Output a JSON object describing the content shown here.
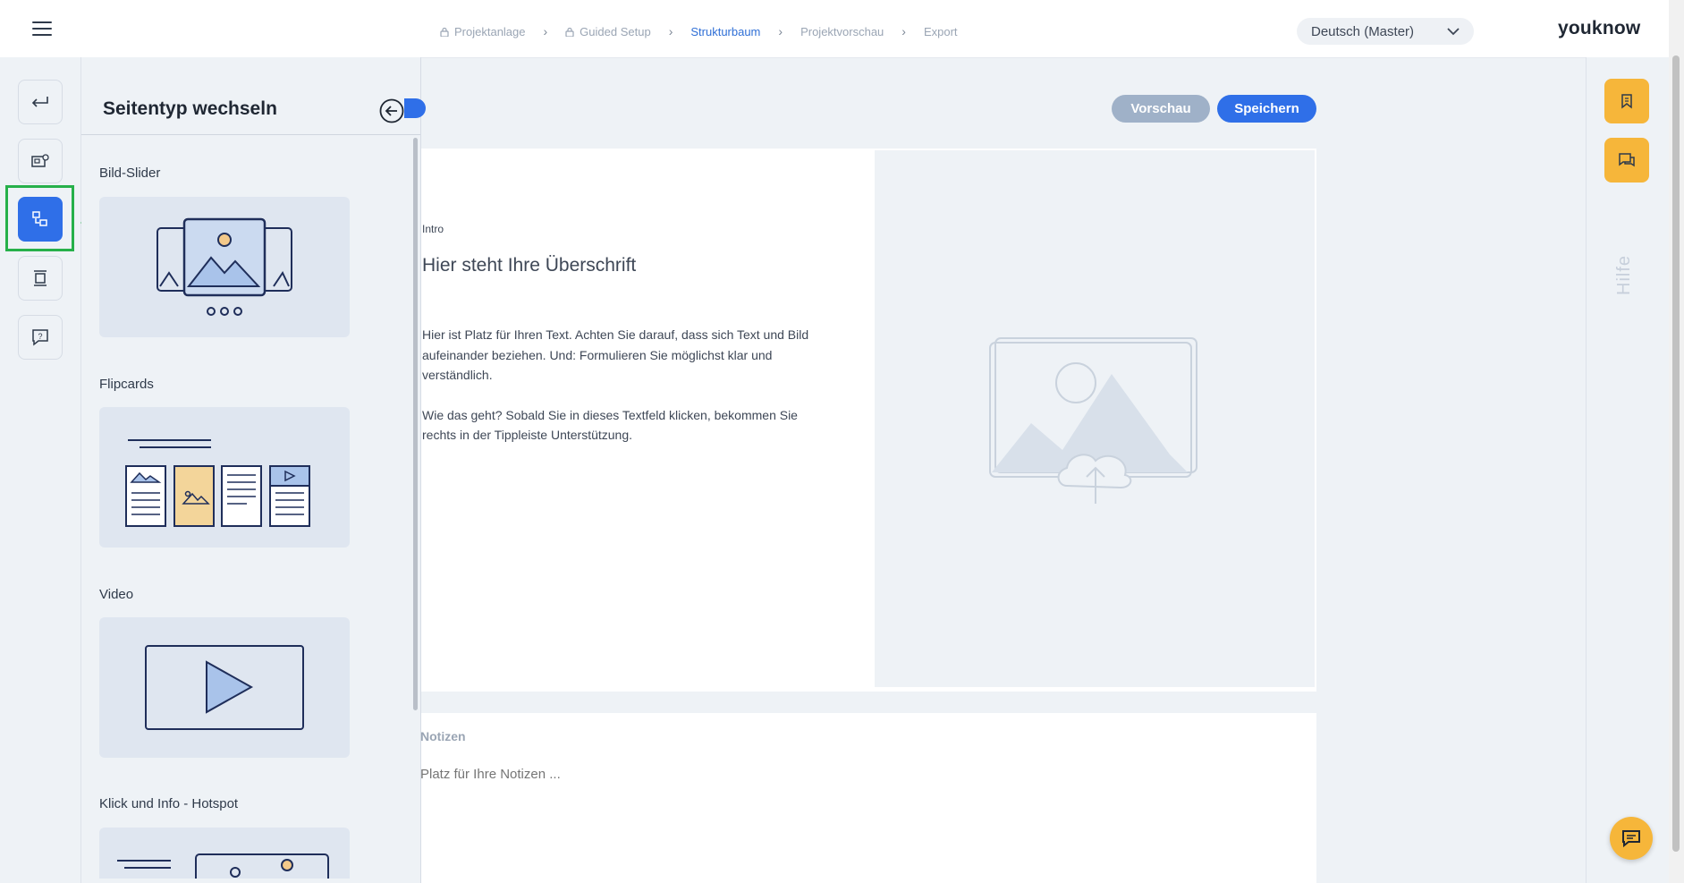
{
  "topbar": {
    "breadcrumb": [
      {
        "label": "Projektanlage",
        "locked": true
      },
      {
        "label": "Guided Setup",
        "locked": true
      },
      {
        "label": "Strukturbaum",
        "active": true
      },
      {
        "label": "Projektvorschau"
      },
      {
        "label": "Export"
      }
    ],
    "language": "Deutsch (Master)",
    "brand": "youknow"
  },
  "panel": {
    "title": "Seitentyp wechseln",
    "sections": [
      {
        "label": "Bild-Slider"
      },
      {
        "label": "Flipcards"
      },
      {
        "label": "Video"
      },
      {
        "label": "Klick und Info - Hotspot"
      }
    ]
  },
  "toolbar": {
    "preview_label": "Vorschau",
    "save_label": "Speichern"
  },
  "page": {
    "intro": "Intro",
    "headline": "Hier steht Ihre Überschrift",
    "body_1": "Hier ist Platz für Ihren Text. Achten Sie darauf, dass sich Text und Bild aufeinander beziehen. Und: Formulieren Sie möglichst klar und verständlich.",
    "body_2": "Wie das geht? Sobald Sie in dieses Textfeld klicken, bekommen Sie rechts in der Tippleiste Unterstützung."
  },
  "notes": {
    "title": "Notizen",
    "placeholder": "Platz für Ihre Notizen ..."
  },
  "right_rail": {
    "help_label": "Hilfe"
  },
  "colors": {
    "accent": "#2f6fe8",
    "secondary_button": "#9fb1c8",
    "help_button": "#f6b63a",
    "highlight": "#26b04a"
  },
  "icons": [
    "hamburger-icon",
    "lock-icon",
    "chevron-right-icon",
    "chevron-down-icon",
    "return-icon",
    "page-settings-icon",
    "switch-page-type-icon",
    "layout-icon",
    "feedback-icon",
    "back-arrow-icon",
    "bookmark-icon",
    "comments-icon",
    "chat-icon",
    "arrow-left-icon"
  ]
}
